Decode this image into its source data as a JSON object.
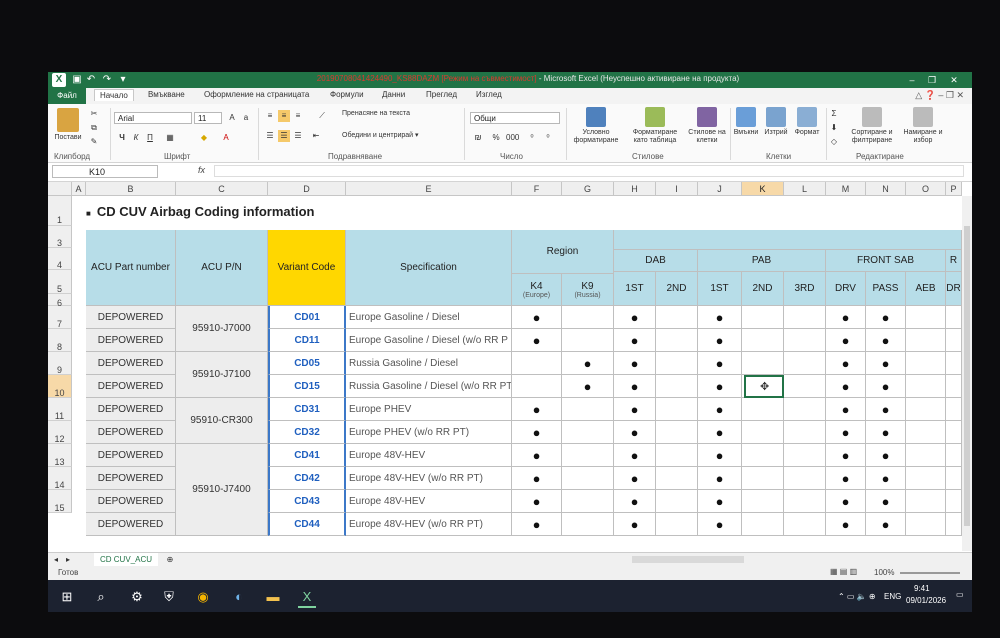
{
  "window": {
    "title_file": "20190708041424490_KS88DAZM",
    "title_mode": "[Режим на съвместимост]",
    "title_app": "- Microsoft Excel (Неуспешно активиране на продукта)",
    "excel_logo": "X"
  },
  "ribbon_tabs": [
    "Файл",
    "Начало",
    "Вмъкване",
    "Оформление на страницата",
    "Формули",
    "Данни",
    "Преглед",
    "Изглед"
  ],
  "clipboard": {
    "paste": "Постави",
    "group": "Клипборд"
  },
  "font": {
    "name": "Arial",
    "size": "11",
    "group": "Шрифт"
  },
  "alignment": {
    "wrap": "Пренасяне на текста",
    "merge": "Обедини и центрирай",
    "group": "Подравняване"
  },
  "number": {
    "format": "Общи",
    "group": "Число"
  },
  "styles": {
    "conditional": "Условно форматиране",
    "table": "Форматиране като таблица",
    "cell_styles": "Стилове на клетки",
    "group": "Стилове"
  },
  "cells": {
    "insert": "Вмъкни",
    "delete": "Изтрий",
    "format": "Формат",
    "group": "Клетки"
  },
  "editing": {
    "sort": "Сортиране и филтриране",
    "find": "Намиране и избор",
    "group": "Редактиране"
  },
  "formula_bar": {
    "name_box": "K10",
    "fx": "fx",
    "content": ""
  },
  "columns": [
    "A",
    "B",
    "C",
    "D",
    "E",
    "F",
    "G",
    "H",
    "I",
    "J",
    "K",
    "L",
    "M",
    "N",
    "O",
    "P"
  ],
  "rows": [
    "1",
    "3",
    "4",
    "5",
    "6",
    "7",
    "8",
    "9",
    "10",
    "11",
    "12",
    "13",
    "14",
    "15"
  ],
  "selected_cell": "K10",
  "sheet": {
    "title_bullet": "■",
    "title": "CD CUV Airbag Coding information",
    "headers": {
      "acu_part": "ACU Part number",
      "acu_pn": "ACU P/N",
      "variant": "Variant Code",
      "spec": "Specification",
      "region": "Region",
      "k4": "K4",
      "k4_sub": "(Europe)",
      "k9": "K9",
      "k9_sub": "(Russia)",
      "dab": "DAB",
      "pab": "PAB",
      "front_sab": "FRONT SAB",
      "r_cut": "R",
      "dab_1st": "1ST",
      "dab_2nd": "2ND",
      "pab_1st": "1ST",
      "pab_2nd": "2ND",
      "pab_3rd": "3RD",
      "drv": "DRV",
      "pass": "PASS",
      "aeb": "AEB",
      "dr_cut": "DR"
    },
    "part_numbers": [
      "95910-J7000",
      "95910-J7100",
      "95910-CR300",
      "95910-J7400"
    ],
    "data_rows": [
      {
        "part": "DEPOWERED",
        "code": "CD01",
        "spec": "Europe Gasoline / Diesel",
        "k4": true,
        "k9": false,
        "dab1": true,
        "pab1": true,
        "drv": true,
        "pass": true
      },
      {
        "part": "DEPOWERED",
        "code": "CD11",
        "spec": "Europe Gasoline / Diesel (w/o RR P",
        "k4": true,
        "k9": false,
        "dab1": true,
        "pab1": true,
        "drv": true,
        "pass": true
      },
      {
        "part": "DEPOWERED",
        "code": "CD05",
        "spec": "Russia Gasoline / Diesel",
        "k4": false,
        "k9": true,
        "dab1": true,
        "pab1": true,
        "drv": true,
        "pass": true
      },
      {
        "part": "DEPOWERED",
        "code": "CD15",
        "spec": "Russia Gasoline / Diesel (w/o RR PT)",
        "k4": false,
        "k9": true,
        "dab1": true,
        "pab1": true,
        "drv": true,
        "pass": true
      },
      {
        "part": "DEPOWERED",
        "code": "CD31",
        "spec": "Europe PHEV",
        "k4": true,
        "k9": false,
        "dab1": true,
        "pab1": true,
        "drv": true,
        "pass": true
      },
      {
        "part": "DEPOWERED",
        "code": "CD32",
        "spec": "Europe PHEV (w/o RR PT)",
        "k4": true,
        "k9": false,
        "dab1": true,
        "pab1": true,
        "drv": true,
        "pass": true
      },
      {
        "part": "DEPOWERED",
        "code": "CD41",
        "spec": "Europe 48V-HEV",
        "k4": true,
        "k9": false,
        "dab1": true,
        "pab1": true,
        "drv": true,
        "pass": true
      },
      {
        "part": "DEPOWERED",
        "code": "CD42",
        "spec": "Europe 48V-HEV (w/o RR PT)",
        "k4": true,
        "k9": false,
        "dab1": true,
        "pab1": true,
        "drv": true,
        "pass": true
      },
      {
        "part": "DEPOWERED",
        "code": "CD43",
        "spec": "Europe 48V-HEV",
        "k4": true,
        "k9": false,
        "dab1": true,
        "pab1": true,
        "drv": true,
        "pass": true
      },
      {
        "part": "DEPOWERED",
        "code": "CD44",
        "spec": "Europe 48V-HEV (w/o RR PT)",
        "k4": true,
        "k9": false,
        "dab1": true,
        "pab1": true,
        "drv": true,
        "pass": true
      }
    ],
    "dot_char": "●"
  },
  "sheet_tab": "CD CUV_ACU",
  "status": {
    "ready": "Готов",
    "zoom": "100%"
  },
  "taskbar": {
    "lang": "ENG",
    "time": "9:41",
    "date": "09/01/2026"
  }
}
